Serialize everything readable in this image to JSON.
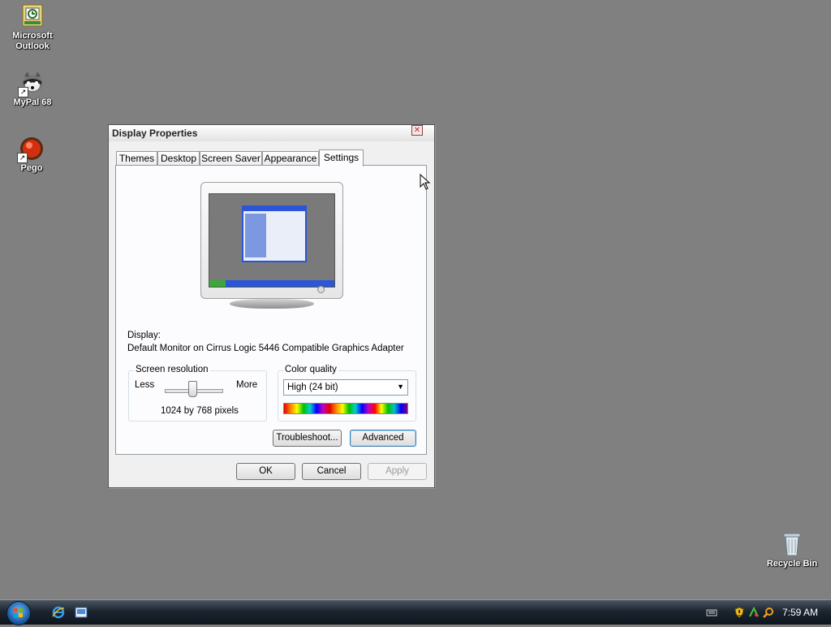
{
  "desktop": {
    "icons": [
      {
        "label": "Microsoft Outlook",
        "icon": "outlook-icon"
      },
      {
        "label": "MyPal 68",
        "icon": "raccoon-icon"
      },
      {
        "label": "Pego",
        "icon": "pego-icon"
      }
    ],
    "recycle_bin": {
      "label": "Recycle Bin",
      "icon": "recycle-bin-icon"
    }
  },
  "dialog": {
    "title": "Display Properties",
    "tabs": [
      {
        "label": "Themes"
      },
      {
        "label": "Desktop"
      },
      {
        "label": "Screen Saver"
      },
      {
        "label": "Appearance"
      },
      {
        "label": "Settings",
        "active": true
      }
    ],
    "display_label": "Display:",
    "display_value": "Default Monitor on Cirrus Logic 5446 Compatible Graphics Adapter",
    "screen_resolution": {
      "legend": "Screen resolution",
      "less": "Less",
      "more": "More",
      "value": "1024 by 768 pixels"
    },
    "color_quality": {
      "legend": "Color quality",
      "selected": "High (24 bit)"
    },
    "buttons": {
      "troubleshoot": "Troubleshoot...",
      "advanced": "Advanced",
      "ok": "OK",
      "cancel": "Cancel",
      "apply": "Apply"
    }
  },
  "taskbar": {
    "clock": "7:59 AM"
  }
}
